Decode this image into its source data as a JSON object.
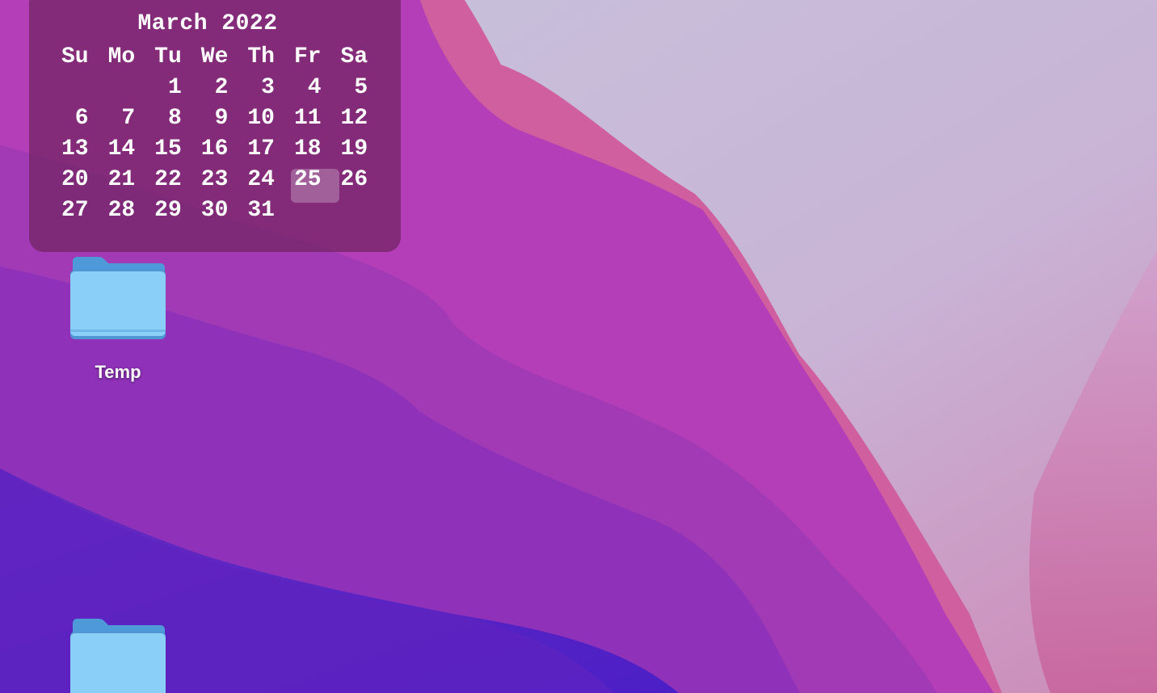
{
  "desktop": {
    "wallpaper_colors": {
      "sky": "#c8c5dd",
      "pink_ridge": "#cf5ea0",
      "magenta": "#b53fb8",
      "violet": "#8e33bb",
      "deep_purple": "#5822c3"
    }
  },
  "calendar": {
    "title": "March 2022",
    "weekdays": [
      "Su",
      "Mo",
      "Tu",
      "We",
      "Th",
      "Fr",
      "Sa"
    ],
    "weeks": [
      [
        "",
        "",
        "1",
        "2",
        "3",
        "4",
        "5"
      ],
      [
        "6",
        "7",
        "8",
        "9",
        "10",
        "11",
        "12"
      ],
      [
        "13",
        "14",
        "15",
        "16",
        "17",
        "18",
        "19"
      ],
      [
        "20",
        "21",
        "22",
        "23",
        "24",
        "25",
        "26"
      ],
      [
        "27",
        "28",
        "29",
        "30",
        "31",
        "",
        ""
      ]
    ],
    "today": "25"
  },
  "icons": [
    {
      "label": "Temp",
      "icon": "folder-icon",
      "color": "#8acff7"
    },
    {
      "label": "",
      "icon": "folder-icon",
      "color": "#8acff7"
    }
  ]
}
